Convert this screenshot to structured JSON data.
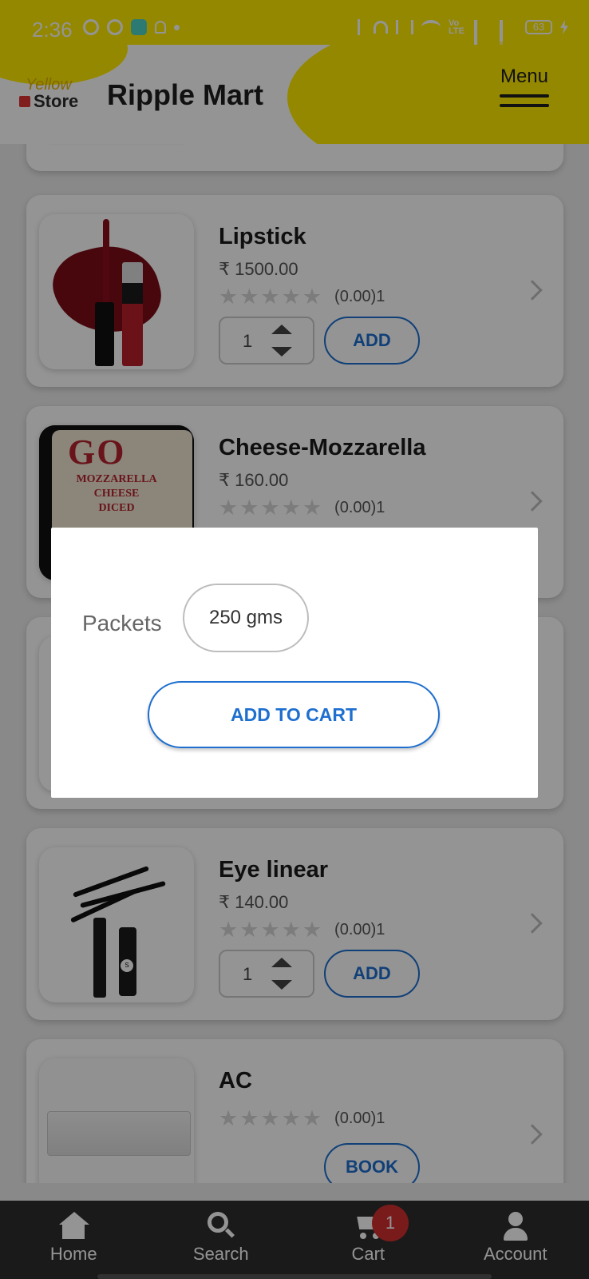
{
  "status_bar": {
    "time": "2:36",
    "battery": "63"
  },
  "header": {
    "logo_line1": "Yellow",
    "logo_line2": "Store",
    "title": "Ripple Mart",
    "menu_label": "Menu"
  },
  "products": [
    {
      "name": "Lipstick",
      "price": "₹ 1500.00",
      "stars": "★★★★★",
      "rating_text": "(0.00)1",
      "qty": "1",
      "action": "ADD"
    },
    {
      "name": "Cheese-Mozzarella",
      "price": "₹ 160.00",
      "stars": "★★★★★",
      "rating_text": "(0.00)1",
      "image_text": [
        "GO",
        "MOZZARELLA",
        "CHEESE",
        "DICED"
      ]
    },
    {
      "name": "Eye linear",
      "price": "₹ 140.00",
      "stars": "★★★★★",
      "rating_text": "(0.00)1",
      "qty": "1",
      "action": "ADD"
    },
    {
      "name": "AC",
      "stars": "★★★★★",
      "rating_text": "(0.00)1",
      "action": "BOOK"
    }
  ],
  "dialog": {
    "unit_label": "Packets",
    "option": "250 gms",
    "add_to_cart": "ADD TO CART"
  },
  "bottom_nav": [
    {
      "label": "Home",
      "icon": "home-icon"
    },
    {
      "label": "Search",
      "icon": "search-icon"
    },
    {
      "label": "Cart",
      "icon": "cart-icon"
    },
    {
      "label": "Account",
      "icon": "account-icon"
    }
  ],
  "cart_badge": "1",
  "colors": {
    "accent": "#1e6fcf",
    "brand_yellow": "#ffea00",
    "badge_red": "#d32f2f",
    "nav_bg": "#2e2e2e"
  }
}
